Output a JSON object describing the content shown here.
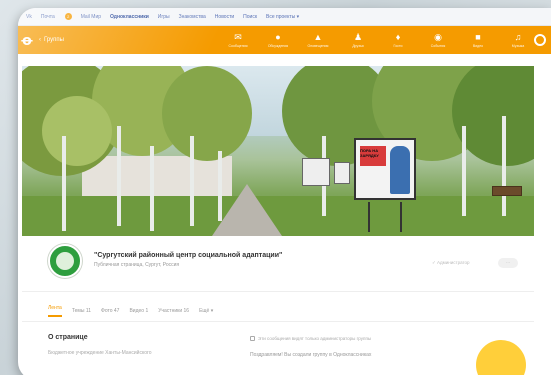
{
  "portal": {
    "items": [
      "Vk",
      "Почта",
      "Mail Мир",
      "Одноклассники",
      "Игры",
      "Знакомства",
      "Новости",
      "Поиск",
      "Все проекты ▾"
    ],
    "active_index": 3,
    "badge_count": "2"
  },
  "toolbar": {
    "logo": "ok",
    "back_label": "Группы",
    "nav": [
      {
        "icon": "envelope-icon",
        "glyph": "✉",
        "label": "Сообщения"
      },
      {
        "icon": "chat-icon",
        "glyph": "●",
        "label": "Обсуждения"
      },
      {
        "icon": "bell-icon",
        "glyph": "▲",
        "label": "Оповещения"
      },
      {
        "icon": "friends-icon",
        "glyph": "♟",
        "label": "Друзья"
      },
      {
        "icon": "guests-icon",
        "glyph": "♦",
        "label": "Гости"
      },
      {
        "icon": "events-icon",
        "glyph": "◉",
        "label": "События"
      },
      {
        "icon": "video-icon",
        "glyph": "■",
        "label": "Видео"
      },
      {
        "icon": "music-icon",
        "glyph": "♫",
        "label": "Музыка"
      }
    ]
  },
  "cover": {
    "caption": "",
    "billboard_text": "ПОРА НА ЗАРЯДКУ"
  },
  "group": {
    "title": "\"Сургутский районный центр социальной адаптации\"",
    "subtitle": "Публичная страница, Сургут, Россия",
    "admin_link": "✓ Администратор",
    "more": "···"
  },
  "tabs": [
    {
      "label": "Лента",
      "active": true
    },
    {
      "label": "Темы 11",
      "active": false
    },
    {
      "label": "Фото 47",
      "active": false
    },
    {
      "label": "Видео 1",
      "active": false
    },
    {
      "label": "Участники 16",
      "active": false
    },
    {
      "label": "Ещё ▾",
      "active": false
    }
  ],
  "about": {
    "title": "О странице",
    "text": "Бюджетное учреждение Ханты-Мансийского"
  },
  "notice": {
    "line1": "Эти сообщения видят только администраторы группы",
    "line2": "Поздравляем! Вы создали группу в Одноклассниках"
  },
  "colors": {
    "accent": "#f59b00",
    "link": "#5a73b6"
  }
}
